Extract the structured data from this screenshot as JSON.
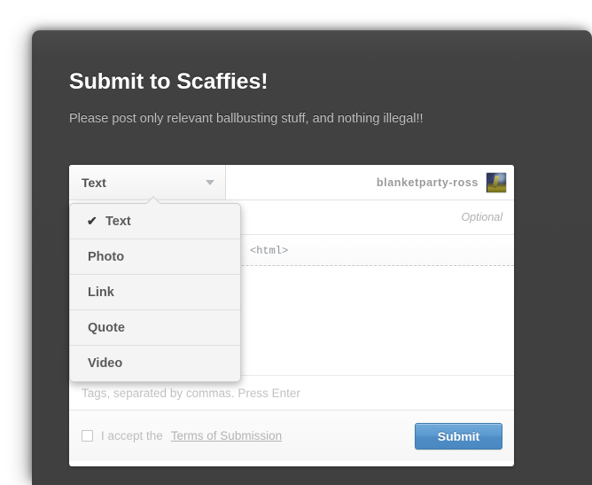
{
  "window": {
    "title": "Submit to Scaffies!",
    "subtitle": "Please post only relevant ballbusting stuff, and nothing illegal!!"
  },
  "form": {
    "post_type": {
      "selected": "Text",
      "caret_icon": "chevron-down-icon",
      "options": [
        {
          "label": "Text",
          "checked": true,
          "check_icon": "check-icon"
        },
        {
          "label": "Photo",
          "checked": false
        },
        {
          "label": "Link",
          "checked": false
        },
        {
          "label": "Quote",
          "checked": false
        },
        {
          "label": "Video",
          "checked": false
        }
      ]
    },
    "account": {
      "username": "blanketparty-ross",
      "avatar_icon": "avatar-thumbnail"
    },
    "title_field": {
      "value": "",
      "hint": "Optional"
    },
    "toolbar": {
      "items": [
        {
          "icon": "link-icon",
          "label": ""
        },
        {
          "icon": "unlink-icon",
          "label": ""
        },
        {
          "icon": "ordered-list-icon",
          "label": ""
        },
        {
          "icon": "unordered-list-icon",
          "label": ""
        },
        {
          "icon": "insert-photo-icon",
          "label": ""
        },
        {
          "icon": "indent-icon",
          "label": ""
        },
        {
          "icon": "html-source-icon",
          "label": "<html>"
        }
      ],
      "html_label": "<html>"
    },
    "body_field": {
      "value": ""
    },
    "tags_field": {
      "value": "",
      "placeholder": "Tags, separated by commas. Press Enter"
    },
    "footer": {
      "accept_text": "I accept the",
      "terms_link": "Terms of Submission",
      "checkbox_checked": false,
      "submit_label": "Submit"
    }
  },
  "colors": {
    "panel_bg": "#404040",
    "card_bg": "#ffffff",
    "submit_blue": "#5b9bd1",
    "submit_border": "#3f7bab",
    "title_white": "#ffffff",
    "subtitle_gray": "#bdbdbd",
    "muted_gray": "#bdbdbd",
    "menu_bg": "#f4f4f4"
  }
}
